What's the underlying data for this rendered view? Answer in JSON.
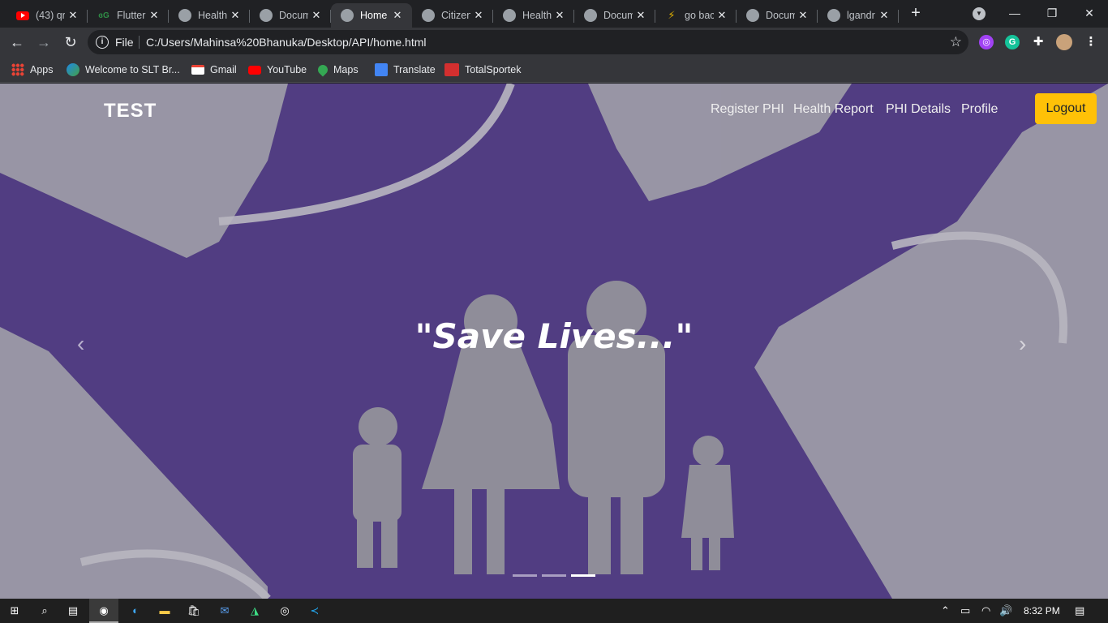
{
  "browser": {
    "tabs": [
      {
        "title": "(43) qr",
        "favicon": "youtube-icon",
        "active": false
      },
      {
        "title": "Flutter",
        "favicon": "geeksforgeeks-icon",
        "active": false
      },
      {
        "title": "Health",
        "favicon": "globe-icon",
        "active": false
      },
      {
        "title": "Docum",
        "favicon": "globe-icon",
        "active": false
      },
      {
        "title": "Home",
        "favicon": "globe-icon",
        "active": true
      },
      {
        "title": "Citizen",
        "favicon": "globe-icon",
        "active": false
      },
      {
        "title": "Health",
        "favicon": "globe-icon",
        "active": false
      },
      {
        "title": "Docum",
        "favicon": "globe-icon",
        "active": false
      },
      {
        "title": "go bac",
        "favicon": "go-icon",
        "active": false
      },
      {
        "title": "Docum",
        "favicon": "globe-icon",
        "active": false
      },
      {
        "title": "lgandr",
        "favicon": "globe-icon",
        "active": false
      }
    ],
    "new_tab_label": "+",
    "address_scheme": "File",
    "address_url": "C:/Users/Mahinsa%20Bhanuka/Desktop/API/home.html",
    "bookmarks": [
      {
        "label": "Apps",
        "icon": "apps-grid-icon"
      },
      {
        "label": "Welcome to SLT Br...",
        "icon": "slt-icon"
      },
      {
        "label": "Gmail",
        "icon": "gmail-icon"
      },
      {
        "label": "YouTube",
        "icon": "youtube-icon"
      },
      {
        "label": "Maps",
        "icon": "maps-icon"
      },
      {
        "label": "Translate",
        "icon": "translate-icon"
      },
      {
        "label": "TotalSportek",
        "icon": "totalsportek-icon"
      }
    ]
  },
  "page": {
    "brand": "TEST",
    "nav": [
      "Register PHI",
      "Health Report",
      "PHI Details",
      "Profile"
    ],
    "logout_label": "Logout",
    "caption": "\"Save Lives...\"",
    "carousel_prev": "‹",
    "carousel_next": "›",
    "carousel_slide_count": 3,
    "carousel_active_index": 2,
    "colors": {
      "background": "#4d3a7a",
      "logout": "#ffc107"
    }
  },
  "taskbar": {
    "clock": "8:32 PM"
  }
}
